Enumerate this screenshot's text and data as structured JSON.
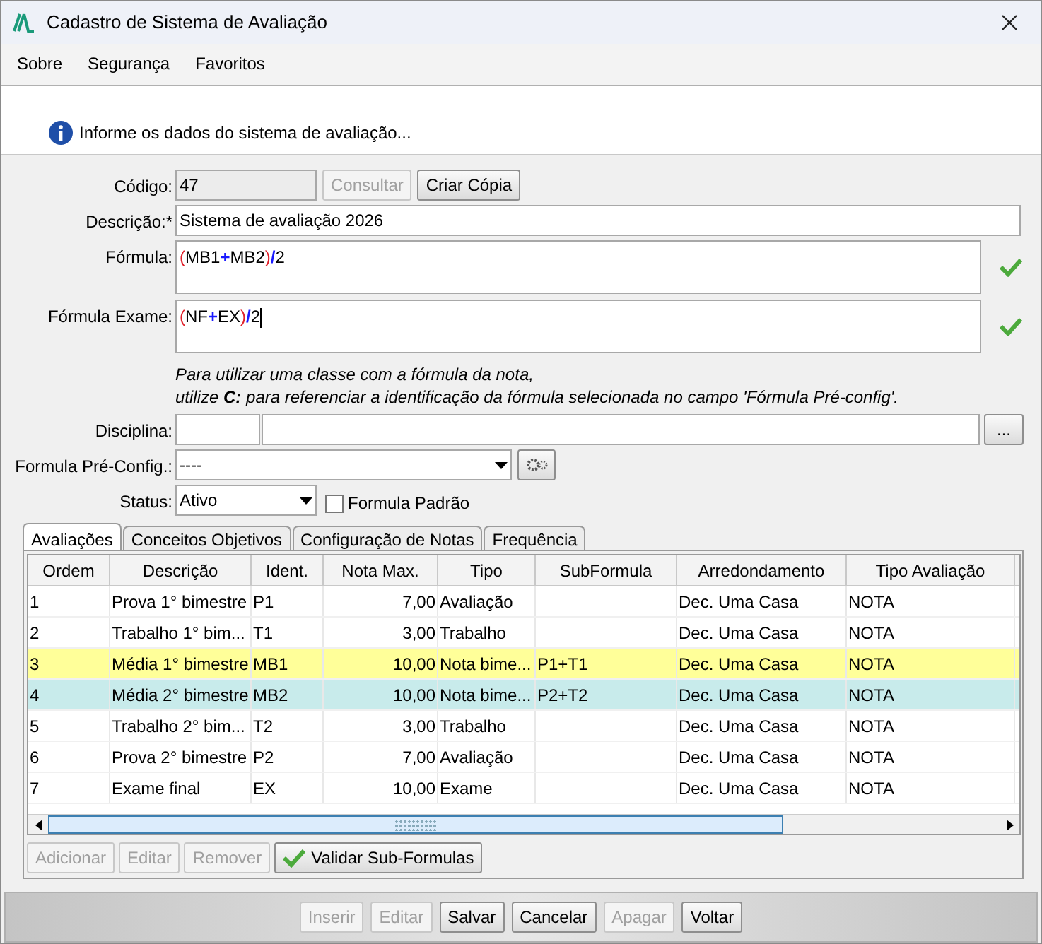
{
  "window": {
    "title": "Cadastro de Sistema de Avaliação"
  },
  "menu": [
    "Sobre",
    "Segurança",
    "Favoritos"
  ],
  "info": "Informe os dados do sistema de avaliação...",
  "codigo": {
    "label": "Código:",
    "value": "47"
  },
  "codigo_buttons": [
    {
      "label": "Consultar",
      "disabled": true
    },
    {
      "label": "Criar Cópia",
      "disabled": false
    }
  ],
  "descricao": {
    "label": "Descrição:*",
    "value": "Sistema de avaliação 2026"
  },
  "formulas": [
    {
      "label": "Fórmula:",
      "valid": true,
      "tokens": [
        {
          "text": "(",
          "kind": "paren"
        },
        {
          "text": "MB1",
          "kind": "name"
        },
        {
          "text": "+",
          "kind": "op"
        },
        {
          "text": "MB2",
          "kind": "name"
        },
        {
          "text": ")",
          "kind": "paren"
        },
        {
          "text": "/",
          "kind": "op"
        },
        {
          "text": "2",
          "kind": "name"
        }
      ]
    },
    {
      "label": "Fórmula Exame:",
      "valid": true,
      "tokens": [
        {
          "text": "(",
          "kind": "paren"
        },
        {
          "text": "NF",
          "kind": "name"
        },
        {
          "text": "+",
          "kind": "op"
        },
        {
          "text": "EX",
          "kind": "name"
        },
        {
          "text": ")",
          "kind": "paren"
        },
        {
          "text": "/",
          "kind": "op"
        },
        {
          "text": "2",
          "kind": "name"
        }
      ]
    }
  ],
  "hint": [
    "Para utilizar uma classe com a fórmula da nota,",
    "utilize **C:** para referenciar a identificação da fórmula selecionada no campo 'Fórmula Pré-config'."
  ],
  "disciplina": {
    "label": "Disciplina:",
    "button": "..."
  },
  "formula_pre_config": {
    "label": "Formula Pré-Config.:",
    "value": "----"
  },
  "status": {
    "label": "Status:",
    "value": "Ativo"
  },
  "formula_padrao": {
    "label": "Formula Padrão",
    "checked": false
  },
  "tabs": [
    {
      "label": "Avaliações",
      "selected": true
    },
    {
      "label": "Conceitos Objetivos",
      "selected": false
    },
    {
      "label": "Configuração de Notas",
      "selected": false
    },
    {
      "label": "Frequência",
      "selected": false
    }
  ],
  "table": {
    "columns": [
      "Ordem",
      "Descrição",
      "Ident.",
      "Nota Max.",
      "Tipo",
      "SubFormula",
      "Arredondamento",
      "Tipo Avaliação"
    ],
    "rows": [
      {
        "cells": [
          "1",
          "Prova 1° bimestre",
          "P1",
          "7,00",
          "Avaliação",
          "",
          "Dec. Uma Casa",
          "NOTA"
        ]
      },
      {
        "cells": [
          "2",
          "Trabalho 1° bim...",
          "T1",
          "3,00",
          "Trabalho",
          "",
          "Dec. Uma Casa",
          "NOTA"
        ]
      },
      {
        "cells": [
          "3",
          "Média 1° bimestre",
          "MB1",
          "10,00",
          "Nota bime...",
          "P1+T1",
          "Dec. Uma Casa",
          "NOTA"
        ],
        "color": "#ffff99"
      },
      {
        "cells": [
          "4",
          "Média 2° bimestre",
          "MB2",
          "10,00",
          "Nota bime...",
          "P2+T2",
          "Dec. Uma Casa",
          "NOTA"
        ],
        "color": "#c8ebeb"
      },
      {
        "cells": [
          "5",
          "Trabalho 2° bim...",
          "T2",
          "3,00",
          "Trabalho",
          "",
          "Dec. Uma Casa",
          "NOTA"
        ]
      },
      {
        "cells": [
          "6",
          "Prova 2° bimestre",
          "P2",
          "7,00",
          "Avaliação",
          "",
          "Dec. Uma Casa",
          "NOTA"
        ]
      },
      {
        "cells": [
          "7",
          "Exame final",
          "EX",
          "10,00",
          "Exame",
          "",
          "Dec. Uma Casa",
          "NOTA"
        ]
      }
    ]
  },
  "table_buttons": [
    {
      "label": "Adicionar",
      "disabled": true
    },
    {
      "label": "Editar",
      "disabled": true
    },
    {
      "label": "Remover",
      "disabled": true
    },
    {
      "label": "Validar Sub-Formulas",
      "disabled": false,
      "kind": "validate"
    }
  ],
  "footer_buttons": [
    {
      "label": "Inserir",
      "disabled": true
    },
    {
      "label": "Editar",
      "disabled": true
    },
    {
      "label": "Salvar",
      "disabled": false
    },
    {
      "label": "Cancelar",
      "disabled": false
    },
    {
      "label": "Apagar",
      "disabled": true
    },
    {
      "label": "Voltar",
      "disabled": false
    }
  ]
}
